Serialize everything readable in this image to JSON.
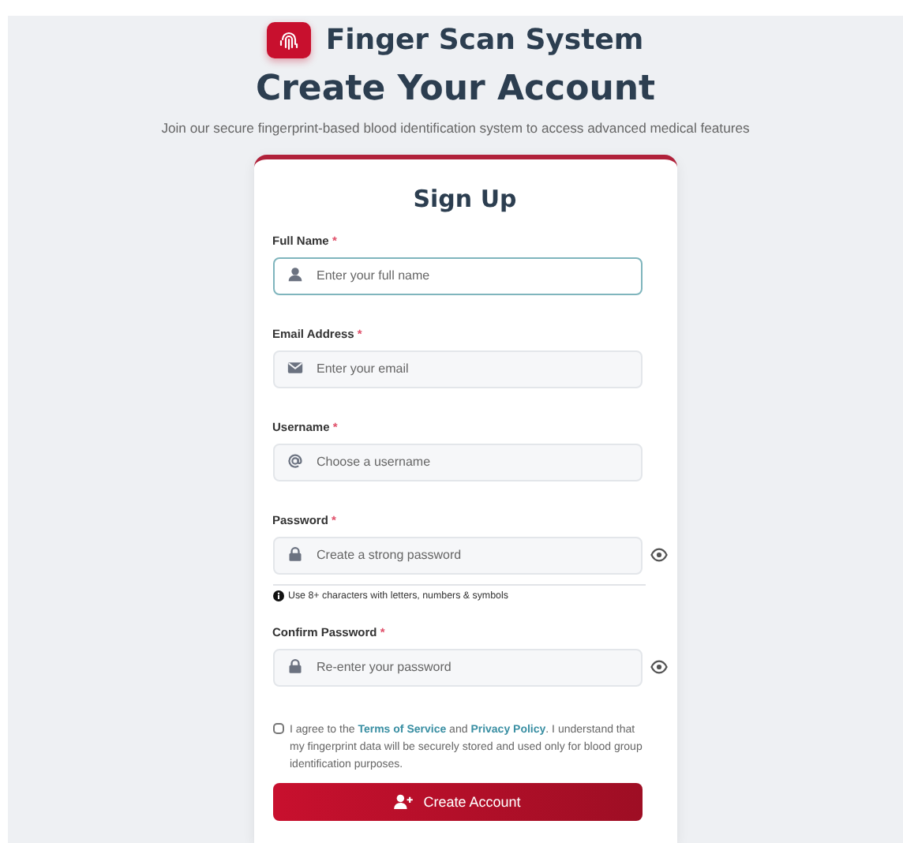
{
  "app": {
    "name": "Finger Scan System"
  },
  "heading": "Create Your Account",
  "subtitle": "Join our secure fingerprint-based blood identification system to access advanced medical features",
  "form": {
    "title": "Sign Up",
    "fields": [
      {
        "label": "Full Name",
        "required_mark": "*",
        "placeholder": "Enter your full name",
        "kind": "text",
        "focused": true
      },
      {
        "label": "Email Address",
        "required_mark": "*",
        "placeholder": "Enter your email",
        "kind": "text",
        "focused": false
      },
      {
        "label": "Username",
        "required_mark": "*",
        "placeholder": "Choose a username",
        "kind": "text",
        "focused": false
      },
      {
        "label": "Password",
        "required_mark": "*",
        "placeholder": "Create a strong password",
        "kind": "password",
        "focused": false,
        "hint": "Use 8+ characters with letters, numbers & symbols"
      },
      {
        "label": "Confirm Password",
        "required_mark": "*",
        "placeholder": "Re-enter your password",
        "kind": "password",
        "focused": false
      }
    ],
    "consent": {
      "checked": false,
      "segments": [
        {
          "kind": "text",
          "text": "I agree to the "
        },
        {
          "kind": "link",
          "text": "Terms of Service"
        },
        {
          "kind": "text",
          "text": " and "
        },
        {
          "kind": "link",
          "text": "Privacy Policy"
        },
        {
          "kind": "text",
          "text": ". I understand that my fingerprint data will be securely stored and used only for blood group identification purposes."
        }
      ]
    },
    "submit": "Create Account"
  }
}
